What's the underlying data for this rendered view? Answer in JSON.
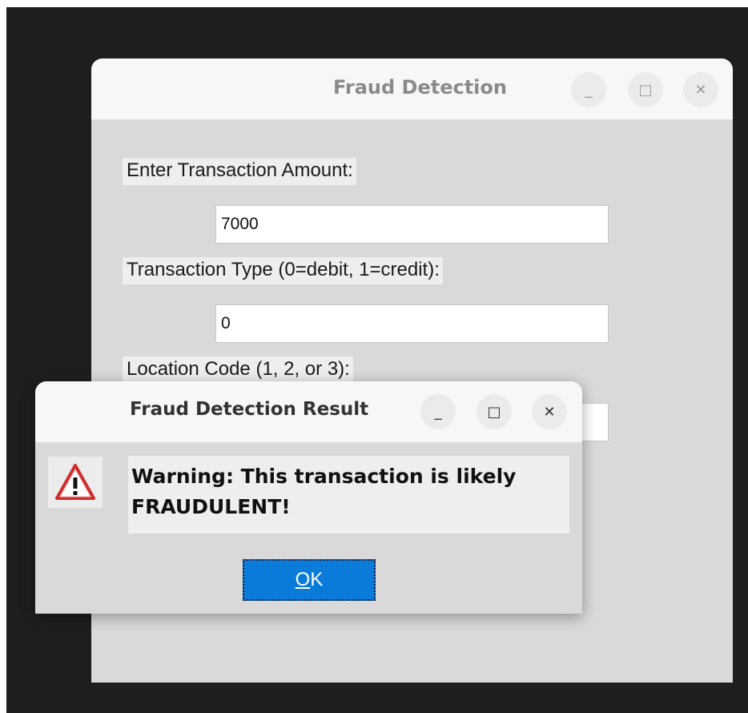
{
  "main_window": {
    "title": "Fraud Detection",
    "controls": {
      "minimize": "_",
      "maximize": "□",
      "close": "✕"
    },
    "fields": [
      {
        "label": "Enter Transaction Amount:",
        "value": "7000"
      },
      {
        "label": "Transaction Type (0=debit, 1=credit):",
        "value": "0"
      },
      {
        "label": "Location Code (1, 2, or 3):",
        "value": ""
      }
    ]
  },
  "dialog": {
    "title": "Fraud Detection Result",
    "controls": {
      "minimize": "_",
      "maximize": "□",
      "close": "✕"
    },
    "icon": "warning-triangle-icon",
    "message": "Warning: This transaction is likely FRAUDULENT!",
    "ok_label_underlined": "O",
    "ok_label_rest": "K"
  },
  "colors": {
    "desktop_bg": "#1e1e1e",
    "window_bg": "#d9d9d9",
    "titlebar_bg": "#f7f7f7",
    "ok_button_bg": "#0a7bd8",
    "warning_red": "#d22b2b"
  }
}
